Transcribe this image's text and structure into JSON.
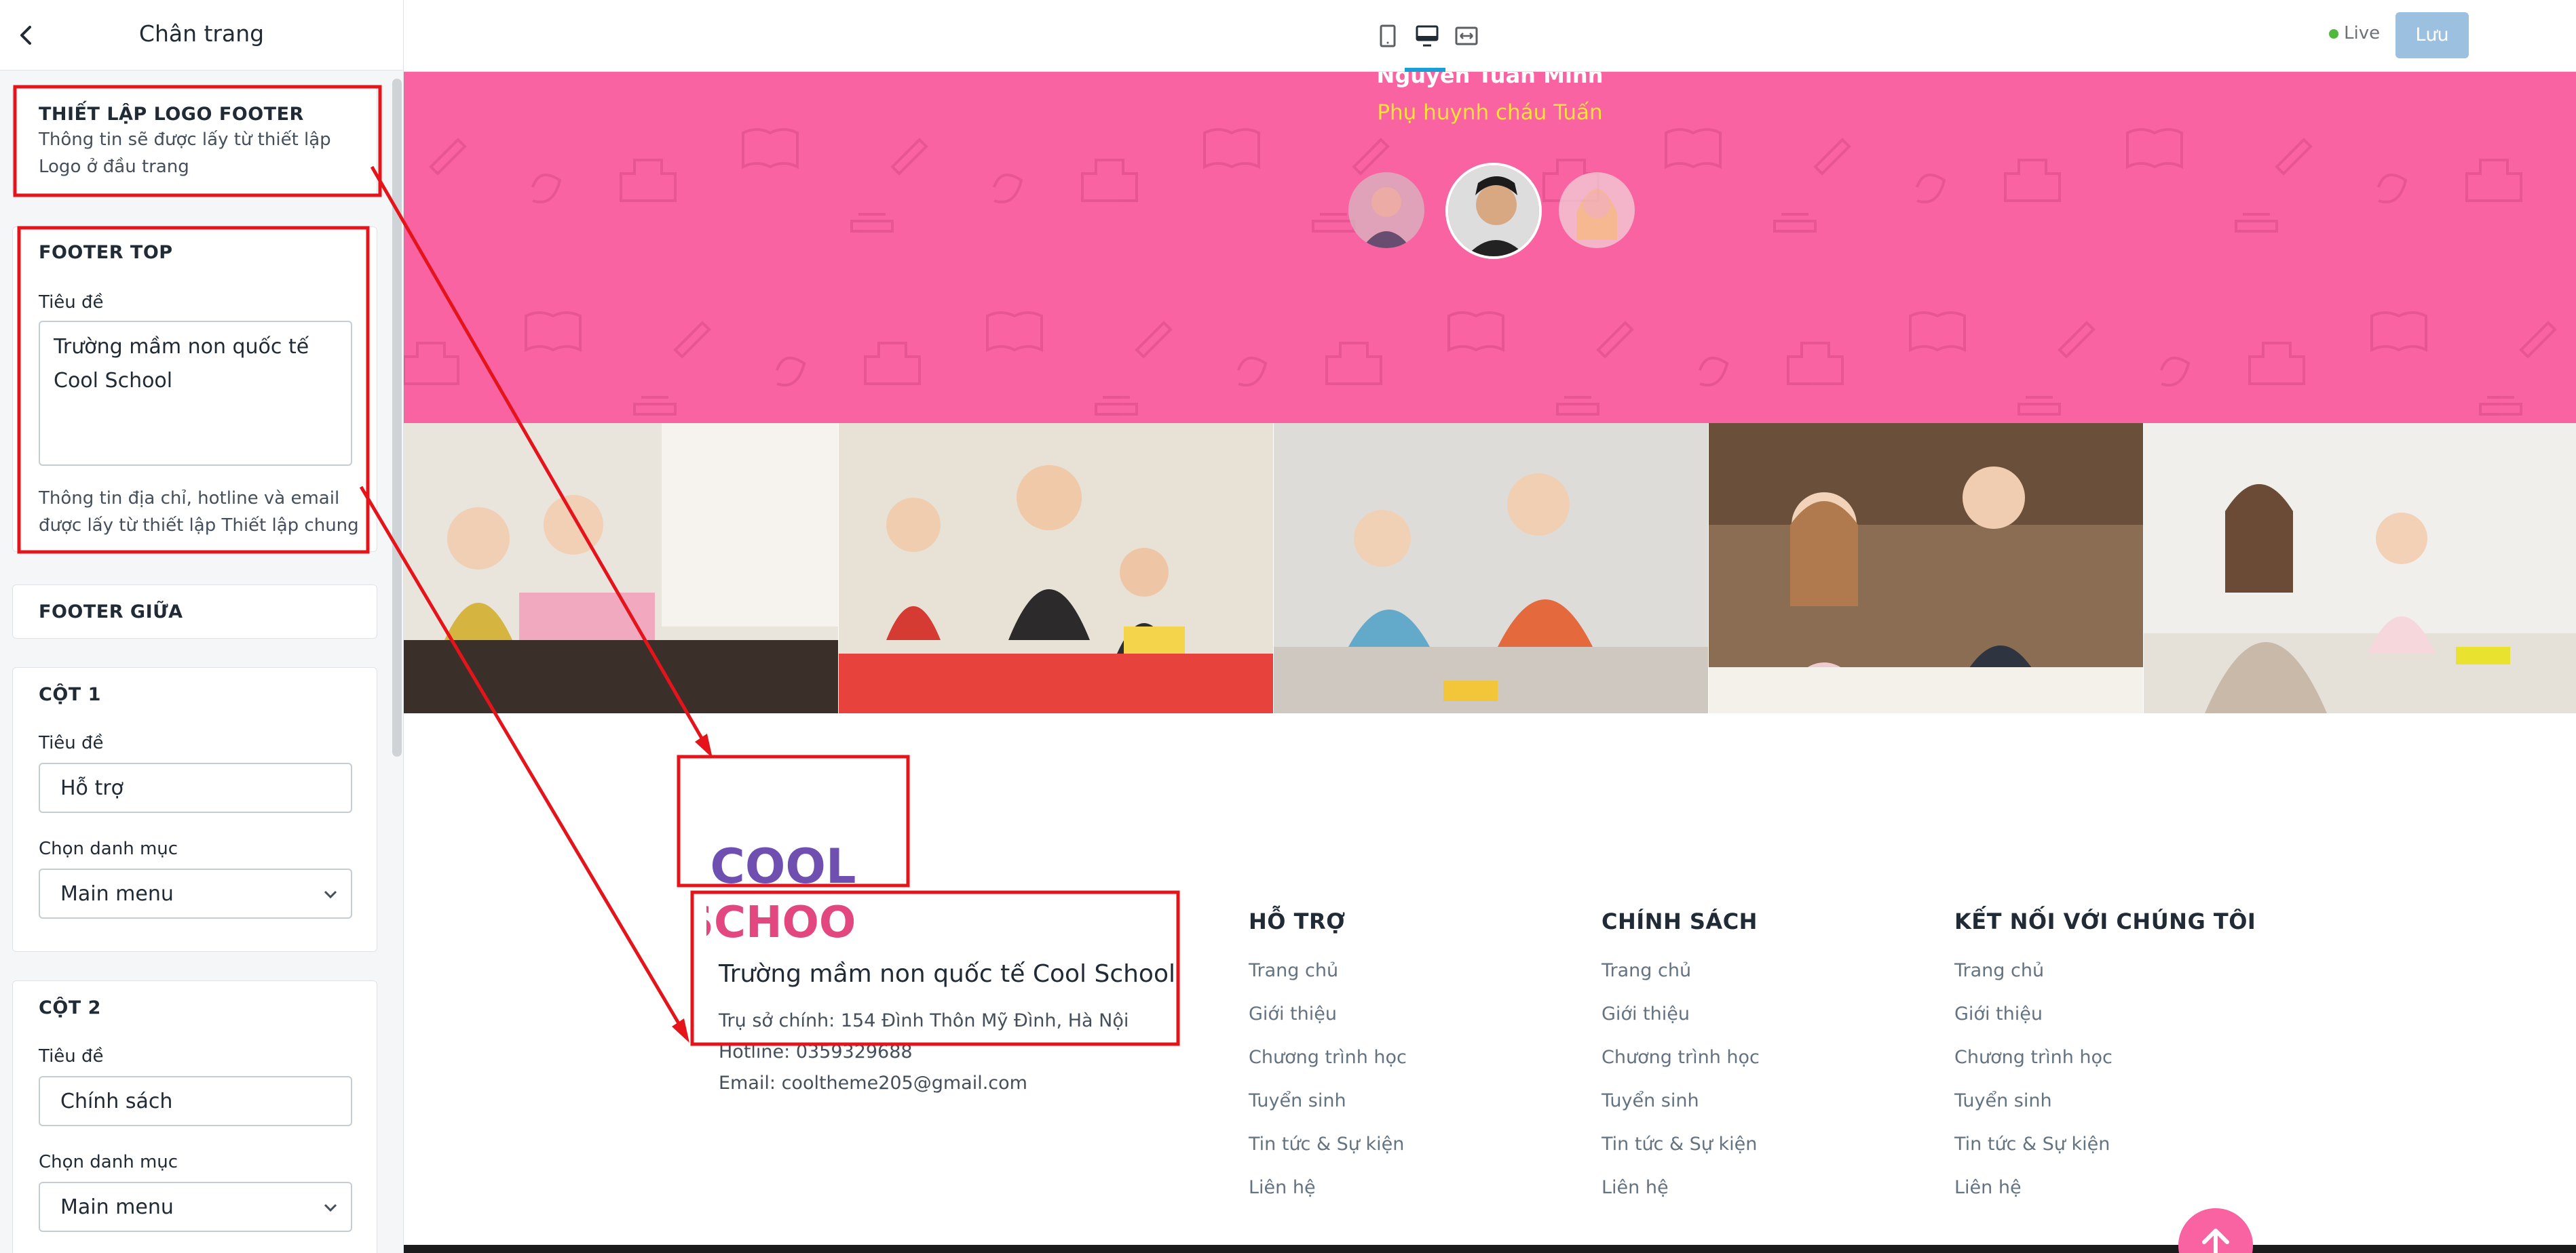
{
  "sidebar": {
    "title": "Chân trang",
    "logo_section": {
      "heading": "THIẾT LẬP LOGO FOOTER",
      "text": "Thông tin sẽ được lấy từ thiết lập Logo ở đầu trang"
    },
    "footer_top": {
      "heading": "FOOTER TOP",
      "title_label": "Tiêu đề",
      "title_value_line1": "Trường mầm non quốc tế",
      "title_value_line2": "Cool School",
      "note": "Thông tin địa chỉ, hotline và email được lấy từ thiết lập Thiết lập chung"
    },
    "footer_middle": {
      "heading": "FOOTER GIỮA"
    },
    "col1": {
      "heading": "CỘT 1",
      "title_label": "Tiêu đề",
      "title_value": "Hỗ trợ",
      "menu_label": "Chọn danh mục",
      "menu_value": "Main menu"
    },
    "col2": {
      "heading": "CỘT 2",
      "title_label": "Tiêu đề",
      "title_value": "Chính sách",
      "menu_label": "Chọn danh mục",
      "menu_value": "Main menu"
    }
  },
  "topbar": {
    "devices": [
      "tablet-icon",
      "desktop-icon",
      "fullwidth-icon"
    ],
    "live_label": "Live",
    "save_label": "Lưu"
  },
  "preview": {
    "testimonial": {
      "name": "Nguyễn Tuấn Minh",
      "role": "Phụ huynh cháu Tuấn"
    },
    "footer": {
      "logo_text_top": "COOL",
      "logo_text_bottom": "SCHOOL",
      "school_name": "Trường mầm non quốc tế Cool School",
      "address": "Trụ sở chính: 154 Đình Thôn Mỹ Đình, Hà Nội",
      "hotline": "Hotline: 0359329688",
      "email": "Email: cooltheme205@gmail.com",
      "columns": [
        {
          "title": "HỖ TRỢ",
          "links": [
            "Trang chủ",
            "Giới thiệu",
            "Chương trình học",
            "Tuyển sinh",
            "Tin tức & Sự kiện",
            "Liên hệ"
          ]
        },
        {
          "title": "CHÍNH SÁCH",
          "links": [
            "Trang chủ",
            "Giới thiệu",
            "Chương trình học",
            "Tuyển sinh",
            "Tin tức & Sự kiện",
            "Liên hệ"
          ]
        },
        {
          "title": "KẾT NỐI VỚI CHÚNG TÔI",
          "links": [
            "Trang chủ",
            "Giới thiệu",
            "Chương trình học",
            "Tuyển sinh",
            "Tin tức & Sự kiện",
            "Liên hệ"
          ]
        }
      ]
    }
  },
  "colors": {
    "pink": "#f963a2",
    "yellow": "#f7e23a",
    "annotation_red": "#e5141b",
    "save_button": "#9cc0e0"
  }
}
